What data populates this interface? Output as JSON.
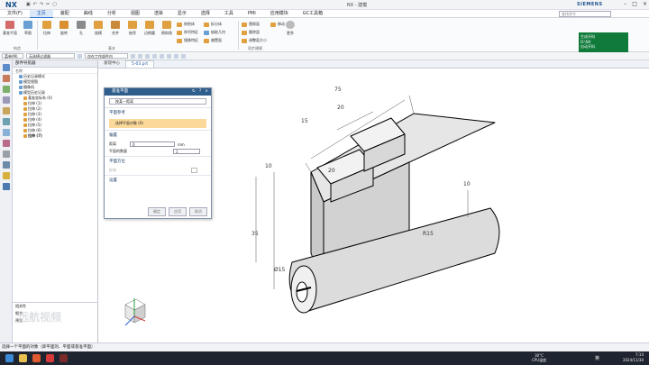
{
  "app": {
    "logo": "NX",
    "window_title": "NX - 建模",
    "brand": "SIEMENS"
  },
  "menu": [
    "文件(F)",
    "主页",
    "装配",
    "曲线",
    "分析",
    "视图",
    "渲染",
    "显示",
    "选择",
    "工具",
    "PMI",
    "应用模块",
    "GC工具箱"
  ],
  "search_placeholder": "查找命令",
  "ribbon": {
    "buttons": [
      {
        "label": "基准平面",
        "color": "#d46a6a"
      },
      {
        "label": "草图",
        "color": "#6a9fd4"
      },
      {
        "label": "拉伸",
        "color": "#e0a040"
      },
      {
        "label": "旋转",
        "color": "#e0a040"
      },
      {
        "label": "孔",
        "color": "#8a8a8a"
      },
      {
        "label": "拔模",
        "color": "#e0a040"
      },
      {
        "label": "合并",
        "color": "#e0a040"
      },
      {
        "label": "抽壳",
        "color": "#e0a040"
      },
      {
        "label": "边倒圆",
        "color": "#e0a040"
      },
      {
        "label": "倒斜角",
        "color": "#e0a040"
      }
    ],
    "small": [
      "修剪体",
      "阵列特征",
      "镜像特征",
      "拆分体",
      "抽取几何",
      "偏置面",
      "替换面",
      "删除面",
      "调整面大小",
      "移动"
    ],
    "groups": [
      "构造",
      "基本",
      "同步建模"
    ],
    "more_label": "更多"
  },
  "green_box": {
    "line1": "生成开料",
    "line2": "D:\\NX",
    "line3": "自动开料"
  },
  "selbar": {
    "filter": "菜单(M)",
    "type_filter": "无选择过滤器",
    "scope": "仅在工作部件内"
  },
  "nav": {
    "title": "部件导航器",
    "columns": "名称",
    "items": [
      {
        "label": "历史记录模式",
        "bold": false,
        "indent": 1
      },
      {
        "label": "模型视图",
        "bold": false,
        "indent": 1
      },
      {
        "label": "摄像机",
        "bold": false,
        "indent": 1
      },
      {
        "label": "模型历史记录",
        "bold": false,
        "indent": 1
      },
      {
        "label": "基准坐标系 (0)",
        "bold": false,
        "indent": 2
      },
      {
        "label": "拉伸 (1)",
        "bold": false,
        "indent": 2
      },
      {
        "label": "拉伸 (2)",
        "bold": false,
        "indent": 2
      },
      {
        "label": "拉伸 (3)",
        "bold": false,
        "indent": 2
      },
      {
        "label": "拉伸 (4)",
        "bold": false,
        "indent": 2
      },
      {
        "label": "拉伸 (5)",
        "bold": false,
        "indent": 2
      },
      {
        "label": "拉伸 (6)",
        "bold": false,
        "indent": 2
      },
      {
        "label": "拉伸 (7)",
        "bold": true,
        "indent": 2
      }
    ],
    "bottom": [
      "相关性",
      "细节",
      "预览"
    ]
  },
  "tabs": [
    "发现中心",
    "5-03.prt"
  ],
  "dialog": {
    "title": "基准平面",
    "type_value": "按某一距离",
    "section_ref": "平面参考",
    "select_label": "选择平面对象 (0)",
    "section_offset": "偏置",
    "distance_label": "距离",
    "distance_value": "0",
    "distance_unit": "mm",
    "plane_count_label": "平面的数量",
    "plane_count_value": "1",
    "section_dir": "平面方位",
    "reverse_label": "反向",
    "section_settings": "设置",
    "ok": "确定",
    "apply": "应用",
    "cancel": "取消"
  },
  "dims": [
    "75",
    "20",
    "15",
    "35",
    "10",
    "20",
    "Ø15",
    "10",
    "R15"
  ],
  "status": "选择一个平面的对象（即平面的、平面或基准平面）",
  "watermark": "远航视频",
  "tray": {
    "temp": "30°C",
    "cpu": "CPU温度",
    "time": "7:14",
    "date": "2024/11/30",
    "input": "英"
  }
}
